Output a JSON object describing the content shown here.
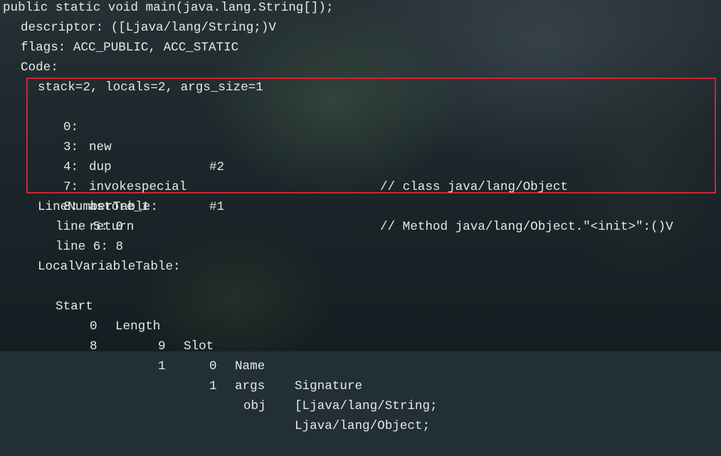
{
  "header": {
    "method_signature": "public static void main(java.lang.String[]);",
    "descriptor": "descriptor: ([Ljava/lang/String;)V",
    "flags": "flags: ACC_PUBLIC, ACC_STATIC",
    "code_label": "Code:"
  },
  "code": {
    "stack_info": "stack=2, locals=2, args_size=1",
    "instructions": [
      {
        "offset": "0:",
        "opcode": "new",
        "operand": "#2",
        "comment": "// class java/lang/Object"
      },
      {
        "offset": "3:",
        "opcode": "dup",
        "operand": "",
        "comment": ""
      },
      {
        "offset": "4:",
        "opcode": "invokespecial",
        "operand": "#1",
        "comment": "// Method java/lang/Object.\"<init>\":()V"
      },
      {
        "offset": "7:",
        "opcode": "astore_1",
        "operand": "",
        "comment": ""
      },
      {
        "offset": "8:",
        "opcode": "return",
        "operand": "",
        "comment": ""
      }
    ]
  },
  "line_number_table": {
    "label": "LineNumberTable:",
    "entries": [
      "line 5: 0",
      "line 6: 8"
    ]
  },
  "local_variable_table": {
    "label": "LocalVariableTable:",
    "headers": [
      "Start",
      "Length",
      "Slot",
      "Name",
      "Signature"
    ],
    "rows": [
      [
        "0",
        "9",
        "0",
        "args",
        "[Ljava/lang/String;"
      ],
      [
        "8",
        "1",
        "1",
        "obj",
        "Ljava/lang/Object;"
      ]
    ]
  },
  "colors": {
    "text": "#e8e8e8",
    "highlight_border": "#d02530",
    "background": "#223036"
  }
}
